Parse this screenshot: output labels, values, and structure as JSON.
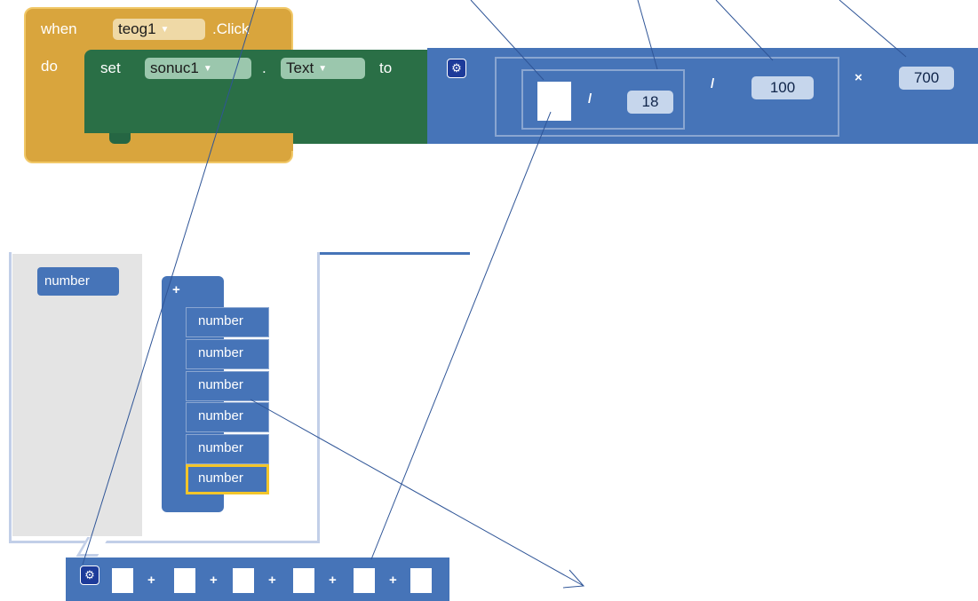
{
  "event_block": {
    "when": "when",
    "component": "teog1",
    "event": ".Click",
    "do": "do"
  },
  "setter_block": {
    "set": "set",
    "component": "sonuc1",
    "dot": ".",
    "property": "Text",
    "to": "to"
  },
  "math": {
    "divide_1": "/",
    "value_1": "18",
    "divide_2": "/",
    "value_2": "100",
    "multiply": "×",
    "value_3": "700"
  },
  "flyout": {
    "container_label": "number",
    "plus_label": "+",
    "items": [
      "number",
      "number",
      "number",
      "number",
      "number",
      "number"
    ]
  },
  "bottom_bar": {
    "operators": [
      "+",
      "+",
      "+",
      "+",
      "+"
    ]
  },
  "icons": {
    "gear": "gear-icon",
    "dropdown": "dropdown-arrow-icon"
  },
  "colors": {
    "event": "#d9a53d",
    "setter": "#2a6f46",
    "math": "#4674b8",
    "selection": "#f2c52a",
    "arrow": "#2f5597"
  }
}
